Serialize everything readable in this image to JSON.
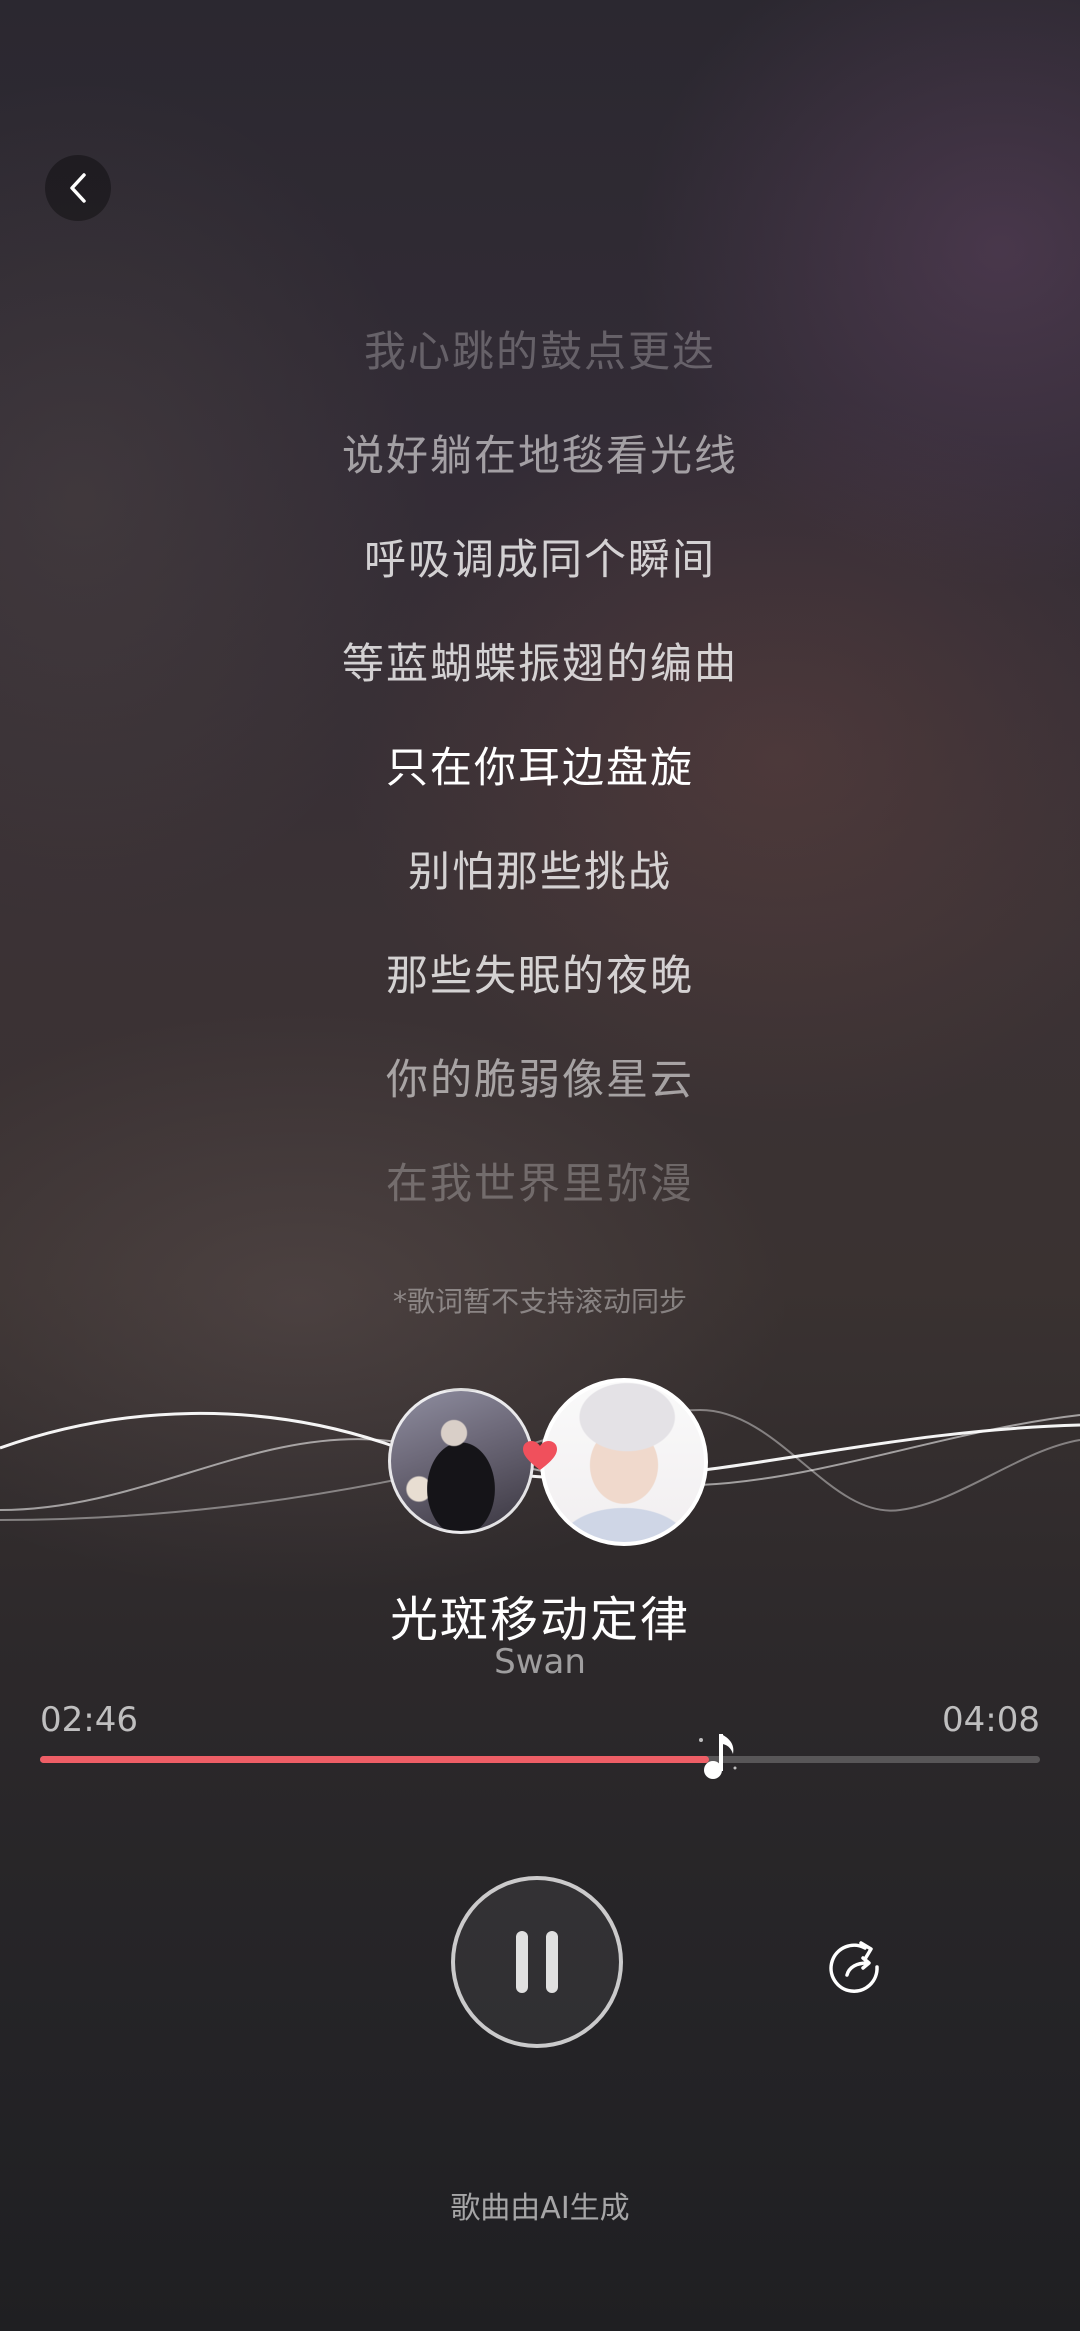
{
  "nav": {
    "back_icon": "chevron-left-icon"
  },
  "lyrics": {
    "lines": [
      "我心跳的鼓点更迭",
      "说好躺在地毯看光线",
      "呼吸调成同个瞬间",
      "等蓝蝴蝶振翅的编曲",
      "只在你耳边盘旋",
      "别怕那些挑战",
      "那些失眠的夜晚",
      "你的脆弱像星云",
      "在我世界里弥漫"
    ],
    "active_index": 4,
    "note": "*歌词暂不支持滚动同步"
  },
  "song": {
    "title": "光斑移动定律",
    "artist": "Swan"
  },
  "player": {
    "current_time": "02:46",
    "total_time": "04:08",
    "progress": 0.669,
    "accent_color": "#ee5e66",
    "play_state": "playing"
  },
  "icons": {
    "heart": "heart-icon",
    "pause": "pause-icon",
    "replay": "replay-icon",
    "thumb": "music-note-icon"
  },
  "footer": {
    "text": "歌曲由AI生成"
  }
}
